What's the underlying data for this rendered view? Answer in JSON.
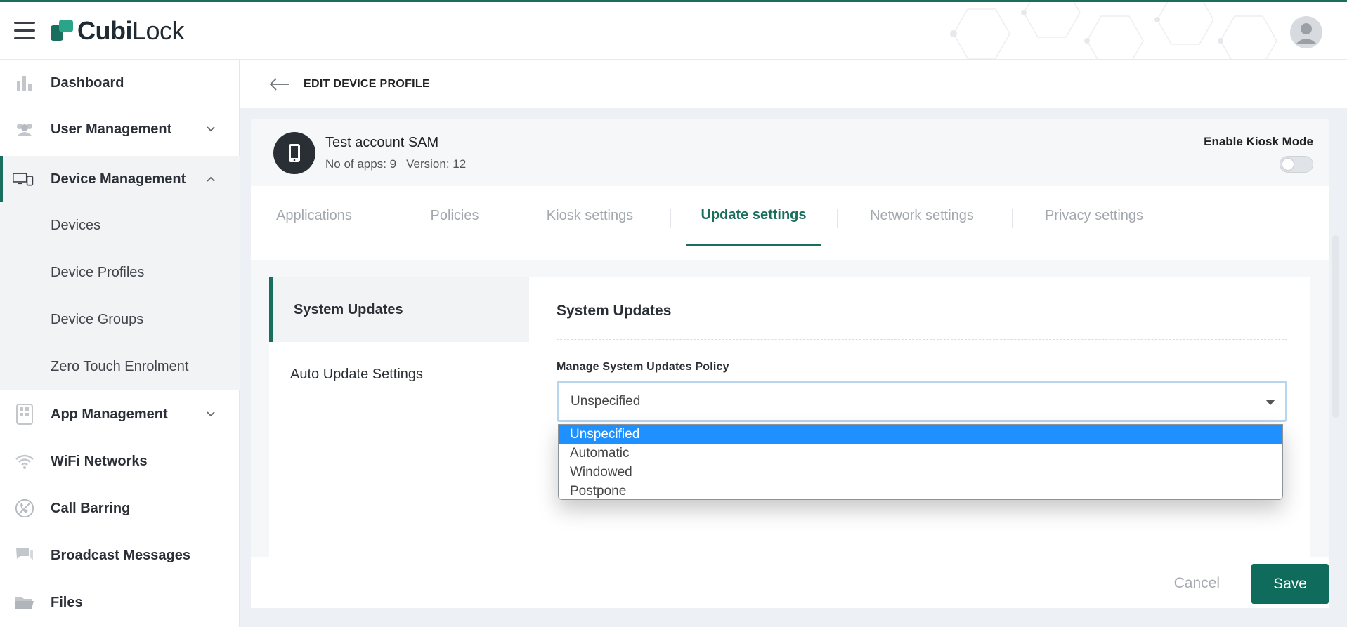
{
  "header": {
    "logo_text_a": "Cubi",
    "logo_text_b": "Lock",
    "menu_icon": "hamburger-icon",
    "avatar_icon": "user-avatar-icon"
  },
  "sidebar": {
    "items": [
      {
        "label": "Dashboard",
        "icon": "bar-chart-icon"
      },
      {
        "label": "User Management",
        "icon": "users-icon"
      },
      {
        "label": "Device Management",
        "icon": "devices-icon"
      },
      {
        "label": "Devices"
      },
      {
        "label": "Device Profiles"
      },
      {
        "label": "Device Groups"
      },
      {
        "label": "Zero Touch Enrolment"
      },
      {
        "label": "App Management",
        "icon": "apps-icon"
      },
      {
        "label": "WiFi Networks",
        "icon": "wifi-icon"
      },
      {
        "label": "Call Barring",
        "icon": "call-barring-icon"
      },
      {
        "label": "Broadcast Messages",
        "icon": "message-icon"
      },
      {
        "label": "Files",
        "icon": "folder-icon"
      }
    ]
  },
  "page": {
    "title": "EDIT DEVICE PROFILE"
  },
  "profile": {
    "name": "Test account SAM",
    "apps": "No of apps: 9",
    "version": "Version: 12",
    "kiosk_label": "Enable Kiosk Mode",
    "kiosk_enabled": false
  },
  "tabs": [
    {
      "label": "Applications"
    },
    {
      "label": "Policies"
    },
    {
      "label": "Kiosk settings"
    },
    {
      "label": "Update settings"
    },
    {
      "label": "Network settings"
    },
    {
      "label": "Privacy settings"
    }
  ],
  "active_tab": "Update settings",
  "leftnav": {
    "items": [
      {
        "label": "System Updates"
      },
      {
        "label": "Auto Update Settings"
      }
    ]
  },
  "panel": {
    "title": "System Updates",
    "field_label": "Manage System Updates Policy",
    "select_value": "Unspecified",
    "options": [
      "Unspecified",
      "Automatic",
      "Windowed",
      "Postpone"
    ]
  },
  "footer": {
    "cancel_label": "Cancel",
    "save_label": "Save"
  },
  "colors": {
    "accent": "#1a6e5e",
    "save_button": "#0f6b5b",
    "selected_option": "#1e90ff"
  }
}
